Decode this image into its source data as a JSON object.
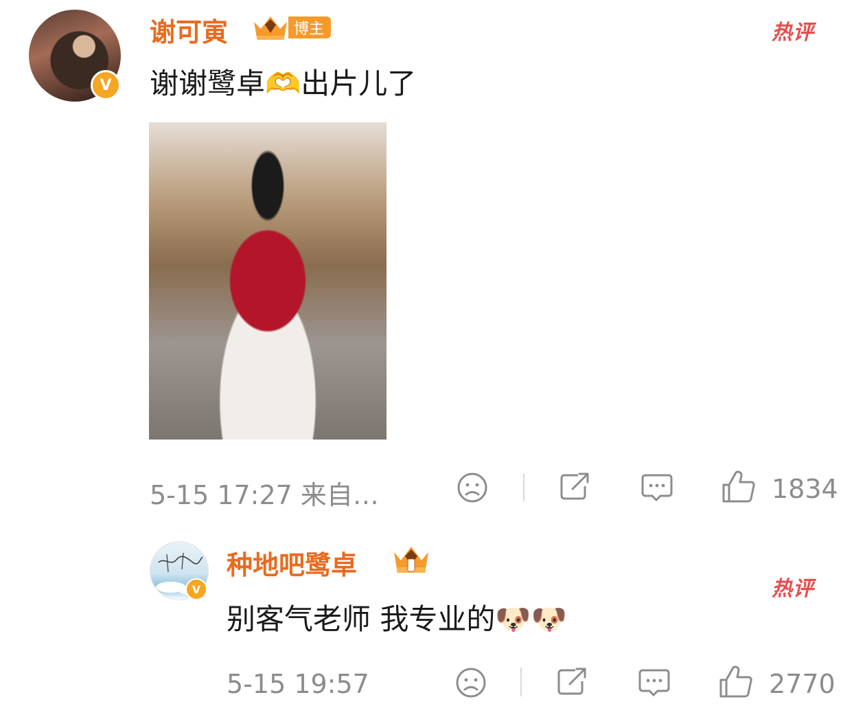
{
  "comments": [
    {
      "username": "谢可寅",
      "badge": "博主",
      "hot_label": "热评",
      "text": "谢谢鹭卓🫶出片儿了",
      "meta": "5-15 17:27  来自…",
      "likes": "1834",
      "verified": "V"
    },
    {
      "username": "种地吧鹭卓",
      "hot_label": "热评",
      "text": "别客气老师 我专业的🐶🐶",
      "meta": "5-15 19:57",
      "likes": "2770",
      "verified": "V"
    }
  ],
  "colors": {
    "username": "#e86b1f",
    "hot": "#e84d4d",
    "meta": "#8c8c8c",
    "badge": "#f5a623"
  },
  "icons": [
    "sad-face-icon",
    "share-icon",
    "comment-icon",
    "thumbs-up-icon",
    "crown-icon",
    "verified-icon"
  ]
}
